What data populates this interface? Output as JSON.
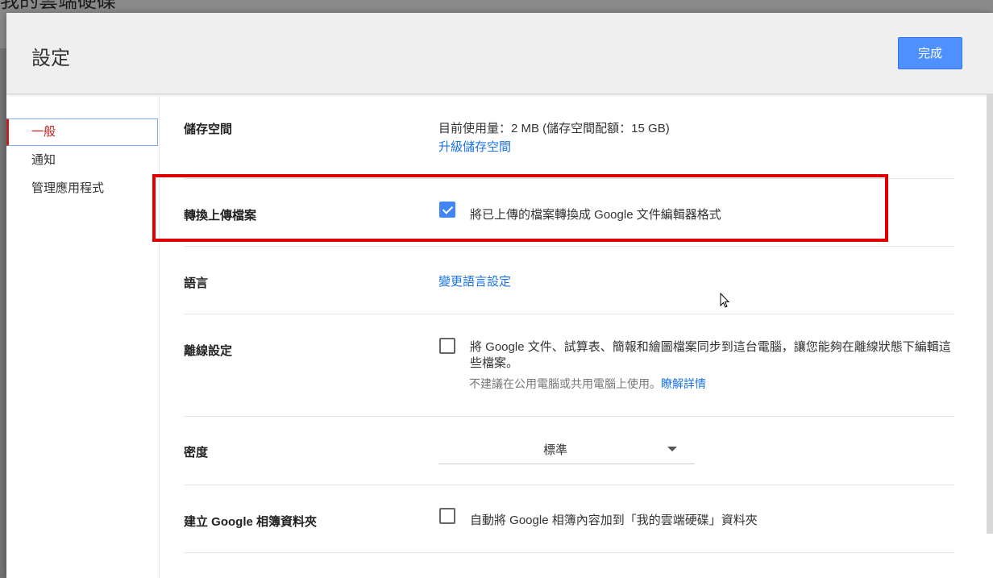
{
  "background": {
    "title": "我的雲端硬碟"
  },
  "dialog": {
    "title": "設定",
    "done_label": "完成"
  },
  "sidebar": {
    "items": [
      {
        "label": "一般",
        "active": true
      },
      {
        "label": "通知",
        "active": false
      },
      {
        "label": "管理應用程式",
        "active": false
      }
    ]
  },
  "settings": {
    "storage": {
      "label": "儲存空間",
      "usage": "目前使用量：2 MB (儲存空間配額：15 GB)",
      "upgrade_link": "升級儲存空間"
    },
    "convert": {
      "label": "轉換上傳檔案",
      "checked": true,
      "text": "將已上傳的檔案轉換成 Google 文件編輯器格式"
    },
    "language": {
      "label": "語言",
      "link": "變更語言設定"
    },
    "offline": {
      "label": "離線設定",
      "checked": false,
      "text": "將 Google 文件、試算表、簡報和繪圖檔案同步到這台電腦，讓您能夠在離線狀態下編輯這些檔案。",
      "note": "不建議在公用電腦或共用電腦上使用。",
      "learn_more": "瞭解詳情"
    },
    "density": {
      "label": "密度",
      "value": "標準"
    },
    "photos": {
      "label": "建立 Google 相簿資料夾",
      "checked": false,
      "text": "自動將 Google 相簿內容加到「我的雲端硬碟」資料夾"
    }
  },
  "colors": {
    "accent": "#4d90fe",
    "active_nav": "#c5221f",
    "link": "#1a73e8",
    "highlight": "#e00000"
  }
}
